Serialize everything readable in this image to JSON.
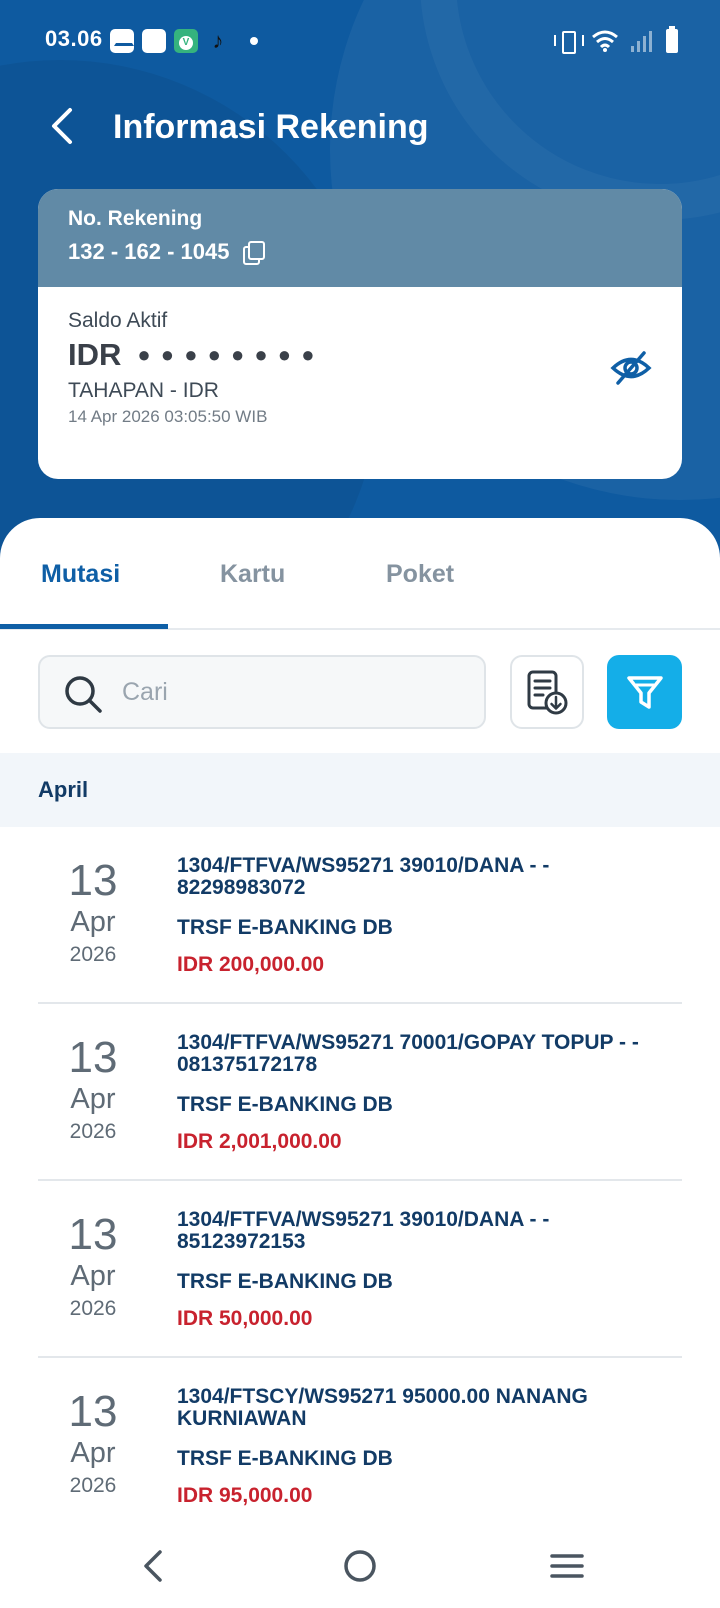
{
  "status_bar": {
    "time": "03.06",
    "notification_icons": [
      "mail-icon",
      "square-icon",
      "v-app-icon",
      "tiktok-icon"
    ],
    "system_icons": [
      "vibrate-icon",
      "wifi-icon",
      "signal-icon",
      "battery-icon"
    ]
  },
  "header": {
    "title": "Informasi Rekening"
  },
  "account_card": {
    "number_label": "No. Rekening",
    "number": "132 - 162 - 1045",
    "balance_label": "Saldo Aktif",
    "currency": "IDR",
    "balance_masked": "● ● ● ● ● ● ● ●",
    "account_type": "TAHAPAN - IDR",
    "timestamp": "14 Apr 2026 03:05:50 WIB"
  },
  "tabs": [
    {
      "label": "Mutasi",
      "active": true
    },
    {
      "label": "Kartu",
      "active": false
    },
    {
      "label": "Poket",
      "active": false
    }
  ],
  "search": {
    "placeholder": "Cari",
    "value": ""
  },
  "month_header": "April",
  "transactions": [
    {
      "day": "13",
      "month": "Apr",
      "year": "2026",
      "description": "1304/FTFVA/WS95271 39010/DANA - - 82298983072",
      "type": "TRSF E-BANKING DB",
      "amount": "IDR 200,000.00"
    },
    {
      "day": "13",
      "month": "Apr",
      "year": "2026",
      "description": "1304/FTFVA/WS95271 70001/GOPAY TOPUP - - 081375172178",
      "type": "TRSF E-BANKING DB",
      "amount": "IDR 2,001,000.00"
    },
    {
      "day": "13",
      "month": "Apr",
      "year": "2026",
      "description": "1304/FTFVA/WS95271 39010/DANA - - 85123972153",
      "type": "TRSF E-BANKING DB",
      "amount": "IDR 50,000.00"
    },
    {
      "day": "13",
      "month": "Apr",
      "year": "2026",
      "description": "1304/FTSCY/WS95271 95000.00 NANANG KURNIAWAN",
      "type": "TRSF E-BANKING DB",
      "amount": "IDR 95,000.00"
    }
  ],
  "colors": {
    "brand_blue": "#0e5aa0",
    "active_tab": "#0f5fa6",
    "filter_button": "#14aee8",
    "debit_amount": "#c8222e"
  }
}
